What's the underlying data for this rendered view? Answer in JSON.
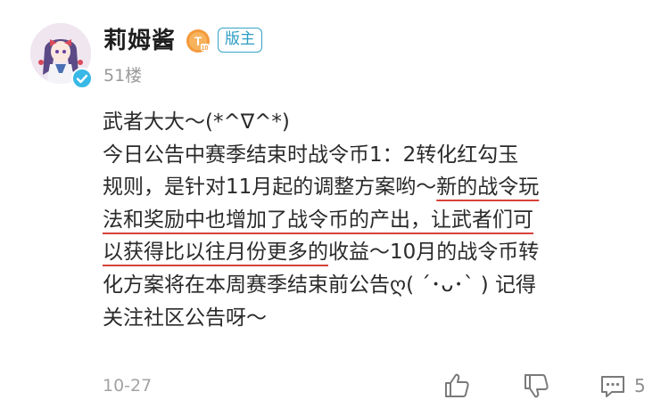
{
  "post": {
    "username": "莉姆酱",
    "role_badge": "版主",
    "floor": "51楼",
    "date": "10-27",
    "comment_count": "5",
    "level_icon": "level-t-icon",
    "accent_color": "#35a3c8",
    "underline_color": "#d6423a",
    "content": {
      "line1": "武者大大～(*^∇^*)",
      "line2": "今日公告中赛季结束时战令币1：2转化红勾玉",
      "line3_a": "规则，是针对11月起的调整方案哟～",
      "line3_b": "新的战令玩",
      "line4": "法和奖励中也增加了战令币的产出，让武者们可",
      "line5_a": "以获得",
      "line5_b": "比以往月份更多的",
      "line5_c": "收益～10月的战令币转",
      "line6": "化方案将在本周赛季结束前公告ღ( ´･ᴗ･` ) 记得",
      "line7": "关注社区公告呀～"
    }
  },
  "icons": {
    "avatar": "avatar-image",
    "verified": "verified-check-icon",
    "like": "thumbs-up-icon",
    "dislike": "thumbs-down-icon",
    "comment": "comment-icon"
  }
}
